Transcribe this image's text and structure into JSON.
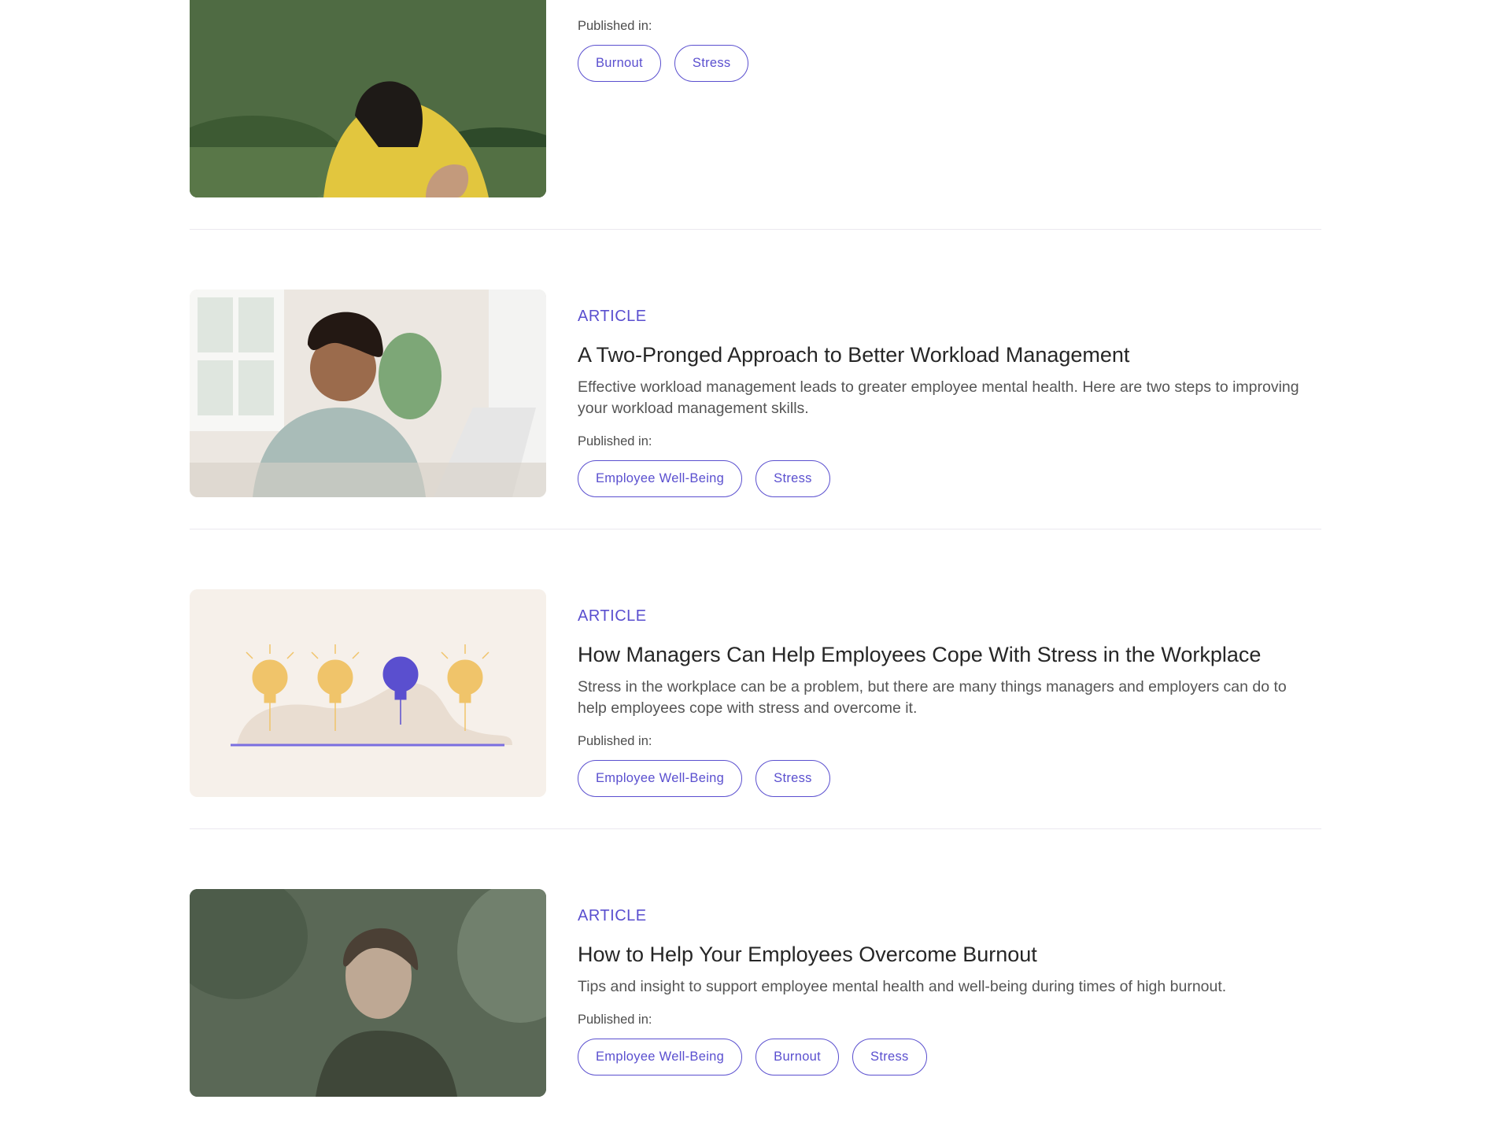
{
  "articles": [
    {
      "kicker": "",
      "title": "",
      "description": "",
      "published_label": "Published in:",
      "tags": [
        "Burnout",
        "Stress"
      ],
      "image": "woman-yellow-sweater-photo"
    },
    {
      "kicker": "ARTICLE",
      "title": "A Two-Pronged Approach to Better Workload Management",
      "description": "Effective workload management leads to greater employee mental health. Here are two steps to improving your workload management skills.",
      "published_label": "Published in:",
      "tags": [
        "Employee Well-Being",
        "Stress"
      ],
      "image": "smiling-woman-laptop-photo"
    },
    {
      "kicker": "ARTICLE",
      "title": "How Managers Can Help Employees Cope With Stress in the Workplace",
      "description": "Stress in the workplace can be a problem, but there are many things managers and employers can do to help employees cope with stress and overcome it.",
      "published_label": "Published in:",
      "tags": [
        "Employee Well-Being",
        "Stress"
      ],
      "image": "lightbulbs-illustration"
    },
    {
      "kicker": "ARTICLE",
      "title": "How to Help Your Employees Overcome Burnout",
      "description": "Tips and insight to support employee mental health and well-being during times of high burnout.",
      "published_label": "Published in:",
      "tags": [
        "Employee Well-Being",
        "Burnout",
        "Stress"
      ],
      "image": "woman-window-reflection-photo"
    }
  ],
  "colors": {
    "accent": "#5a4fcf",
    "divider": "#ebe8ef"
  }
}
